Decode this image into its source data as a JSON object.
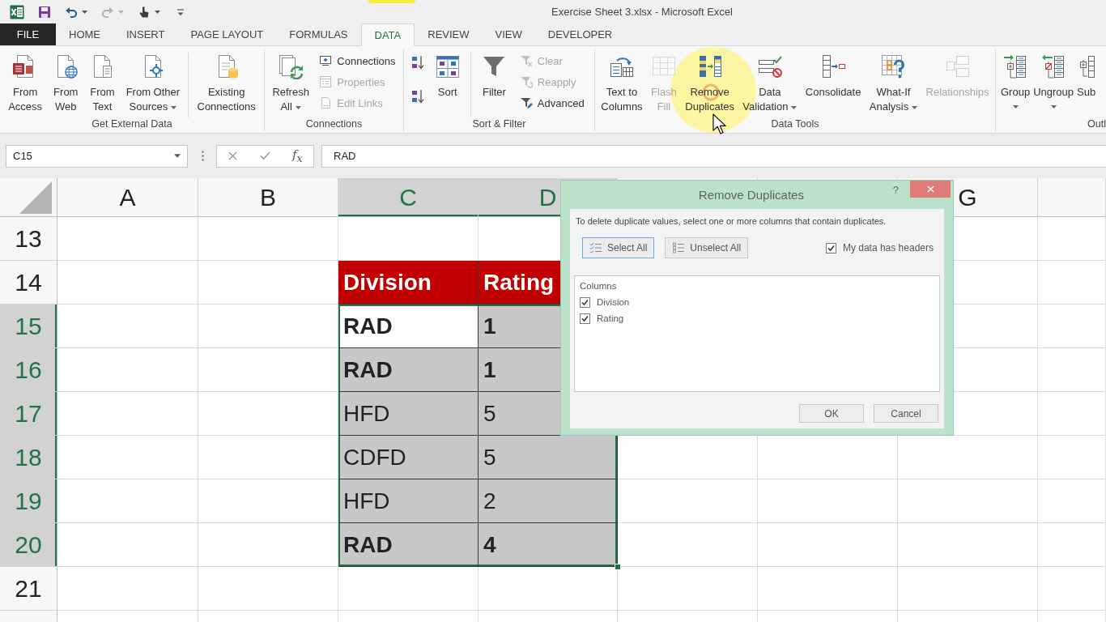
{
  "title_bar": {
    "title": "Exercise Sheet 3.xlsx - Microsoft Excel"
  },
  "quick_access": [
    {
      "kind": "save",
      "disabled": false,
      "dropdown": false
    },
    {
      "kind": "undo",
      "disabled": false,
      "dropdown": true
    },
    {
      "kind": "redo",
      "disabled": true,
      "dropdown": true
    },
    {
      "kind": "touch",
      "disabled": false,
      "dropdown": true
    },
    {
      "kind": "customize",
      "disabled": false,
      "dropdown": false
    }
  ],
  "ribbon_tabs": [
    {
      "label": "FILE",
      "kind": "file",
      "selected": false
    },
    {
      "label": "HOME",
      "kind": "tab",
      "selected": false
    },
    {
      "label": "INSERT",
      "kind": "tab",
      "selected": false
    },
    {
      "label": "PAGE LAYOUT",
      "kind": "tab",
      "selected": false
    },
    {
      "label": "FORMULAS",
      "kind": "tab",
      "selected": false
    },
    {
      "label": "DATA",
      "kind": "tab",
      "selected": true
    },
    {
      "label": "REVIEW",
      "kind": "tab",
      "selected": false
    },
    {
      "label": "VIEW",
      "kind": "tab",
      "selected": false
    },
    {
      "label": "DEVELOPER",
      "kind": "tab",
      "selected": false
    }
  ],
  "ribbon": {
    "groups": [
      {
        "label": "Get External Data",
        "buttons": [
          {
            "label": "From\nAccess",
            "disabled": false,
            "dropdown": false
          },
          {
            "label": "From\nWeb",
            "disabled": false,
            "dropdown": false
          },
          {
            "label": "From\nText",
            "disabled": false,
            "dropdown": false
          },
          {
            "label": "From Other\nSources",
            "disabled": false,
            "dropdown": true
          },
          {
            "label": "Existing\nConnections",
            "disabled": false,
            "dropdown": false
          }
        ]
      },
      {
        "label": "Connections",
        "buttons": [
          {
            "label": "Refresh\nAll",
            "disabled": false,
            "dropdown": true
          },
          {
            "label": "Connections",
            "disabled": false,
            "dropdown": false
          },
          {
            "label": "Properties",
            "disabled": true,
            "dropdown": false
          },
          {
            "label": "Edit Links",
            "disabled": true,
            "dropdown": false
          }
        ]
      },
      {
        "label": "Sort & Filter",
        "buttons": [
          {
            "label": "Sort",
            "disabled": false,
            "dropdown": false
          },
          {
            "label": "Filter",
            "disabled": false,
            "dropdown": false
          },
          {
            "label": "Clear",
            "disabled": true,
            "dropdown": false
          },
          {
            "label": "Reapply",
            "disabled": true,
            "dropdown": false
          },
          {
            "label": "Advanced",
            "disabled": false,
            "dropdown": false
          }
        ]
      },
      {
        "label": "Data Tools",
        "buttons": [
          {
            "label": "Text to\nColumns",
            "disabled": false,
            "dropdown": false
          },
          {
            "label": "Flash\nFill",
            "disabled": true,
            "dropdown": false
          },
          {
            "label": "Remove\nDuplicates",
            "disabled": false,
            "dropdown": false
          },
          {
            "label": "Data\nValidation",
            "disabled": false,
            "dropdown": true
          },
          {
            "label": "Consolidate",
            "disabled": false,
            "dropdown": false
          },
          {
            "label": "What-If\nAnalysis",
            "disabled": false,
            "dropdown": true
          },
          {
            "label": "Relationships",
            "disabled": true,
            "dropdown": false
          }
        ]
      },
      {
        "label": "Outl",
        "buttons": [
          {
            "label": "Group",
            "disabled": false,
            "dropdown": true
          },
          {
            "label": "Ungroup",
            "disabled": false,
            "dropdown": true
          },
          {
            "label": "Sub",
            "disabled": false,
            "dropdown": false
          }
        ]
      }
    ]
  },
  "formula_bar": {
    "name_box": "C15",
    "function_button": "f$_{x}$",
    "formula": "RAD"
  },
  "sheet": {
    "columns": [
      {
        "label": "A",
        "selected": false
      },
      {
        "label": "B",
        "selected": false
      },
      {
        "label": "C",
        "selected": true
      },
      {
        "label": "D",
        "selected": true
      },
      {
        "label": "G",
        "selected": false
      }
    ],
    "rows": [
      {
        "number": "13",
        "selected": false
      },
      {
        "number": "14",
        "selected": false
      },
      {
        "number": "15",
        "selected": true
      },
      {
        "number": "16",
        "selected": true
      },
      {
        "number": "17",
        "selected": true
      },
      {
        "number": "18",
        "selected": true
      },
      {
        "number": "19",
        "selected": true
      },
      {
        "number": "20",
        "selected": true
      },
      {
        "number": "21",
        "selected": false
      }
    ]
  },
  "table": {
    "header": [
      "Division",
      "Rating"
    ],
    "rows": [
      {
        "cells": [
          {
            "text": "RAD",
            "bold": true,
            "selected": true,
            "active": true
          },
          {
            "text": "1",
            "bold": true,
            "selected": true,
            "active": false
          }
        ]
      },
      {
        "cells": [
          {
            "text": "RAD",
            "bold": true,
            "selected": true,
            "active": false
          },
          {
            "text": "1",
            "bold": true,
            "selected": true,
            "active": false
          }
        ]
      },
      {
        "cells": [
          {
            "text": "HFD",
            "bold": false,
            "selected": true,
            "active": false
          },
          {
            "text": "5",
            "bold": false,
            "selected": true,
            "active": false
          }
        ]
      },
      {
        "cells": [
          {
            "text": "CDFD",
            "bold": false,
            "selected": true,
            "active": false
          },
          {
            "text": "5",
            "bold": false,
            "selected": true,
            "active": false
          }
        ]
      },
      {
        "cells": [
          {
            "text": "HFD",
            "bold": false,
            "selected": true,
            "active": false
          },
          {
            "text": "2",
            "bold": false,
            "selected": true,
            "active": false
          }
        ]
      },
      {
        "cells": [
          {
            "text": "RAD",
            "bold": true,
            "selected": true,
            "active": false
          },
          {
            "text": "4",
            "bold": true,
            "selected": true,
            "active": false
          }
        ]
      }
    ]
  },
  "dialog": {
    "title": "Remove Duplicates",
    "help": "?",
    "instruction": "To delete duplicate values, select one or more columns that contain duplicates.",
    "buttons": [
      {
        "label": "Select All",
        "focused": true
      },
      {
        "label": "Unselect All",
        "focused": false
      }
    ],
    "headers_checkbox": {
      "label": "My data has headers",
      "checked": true
    },
    "columns_list": {
      "heading": "Columns",
      "items": [
        {
          "label": "Division",
          "checked": true
        },
        {
          "label": "Rating",
          "checked": true
        }
      ]
    },
    "actions": [
      {
        "label": "OK"
      },
      {
        "label": "Cancel"
      }
    ]
  }
}
